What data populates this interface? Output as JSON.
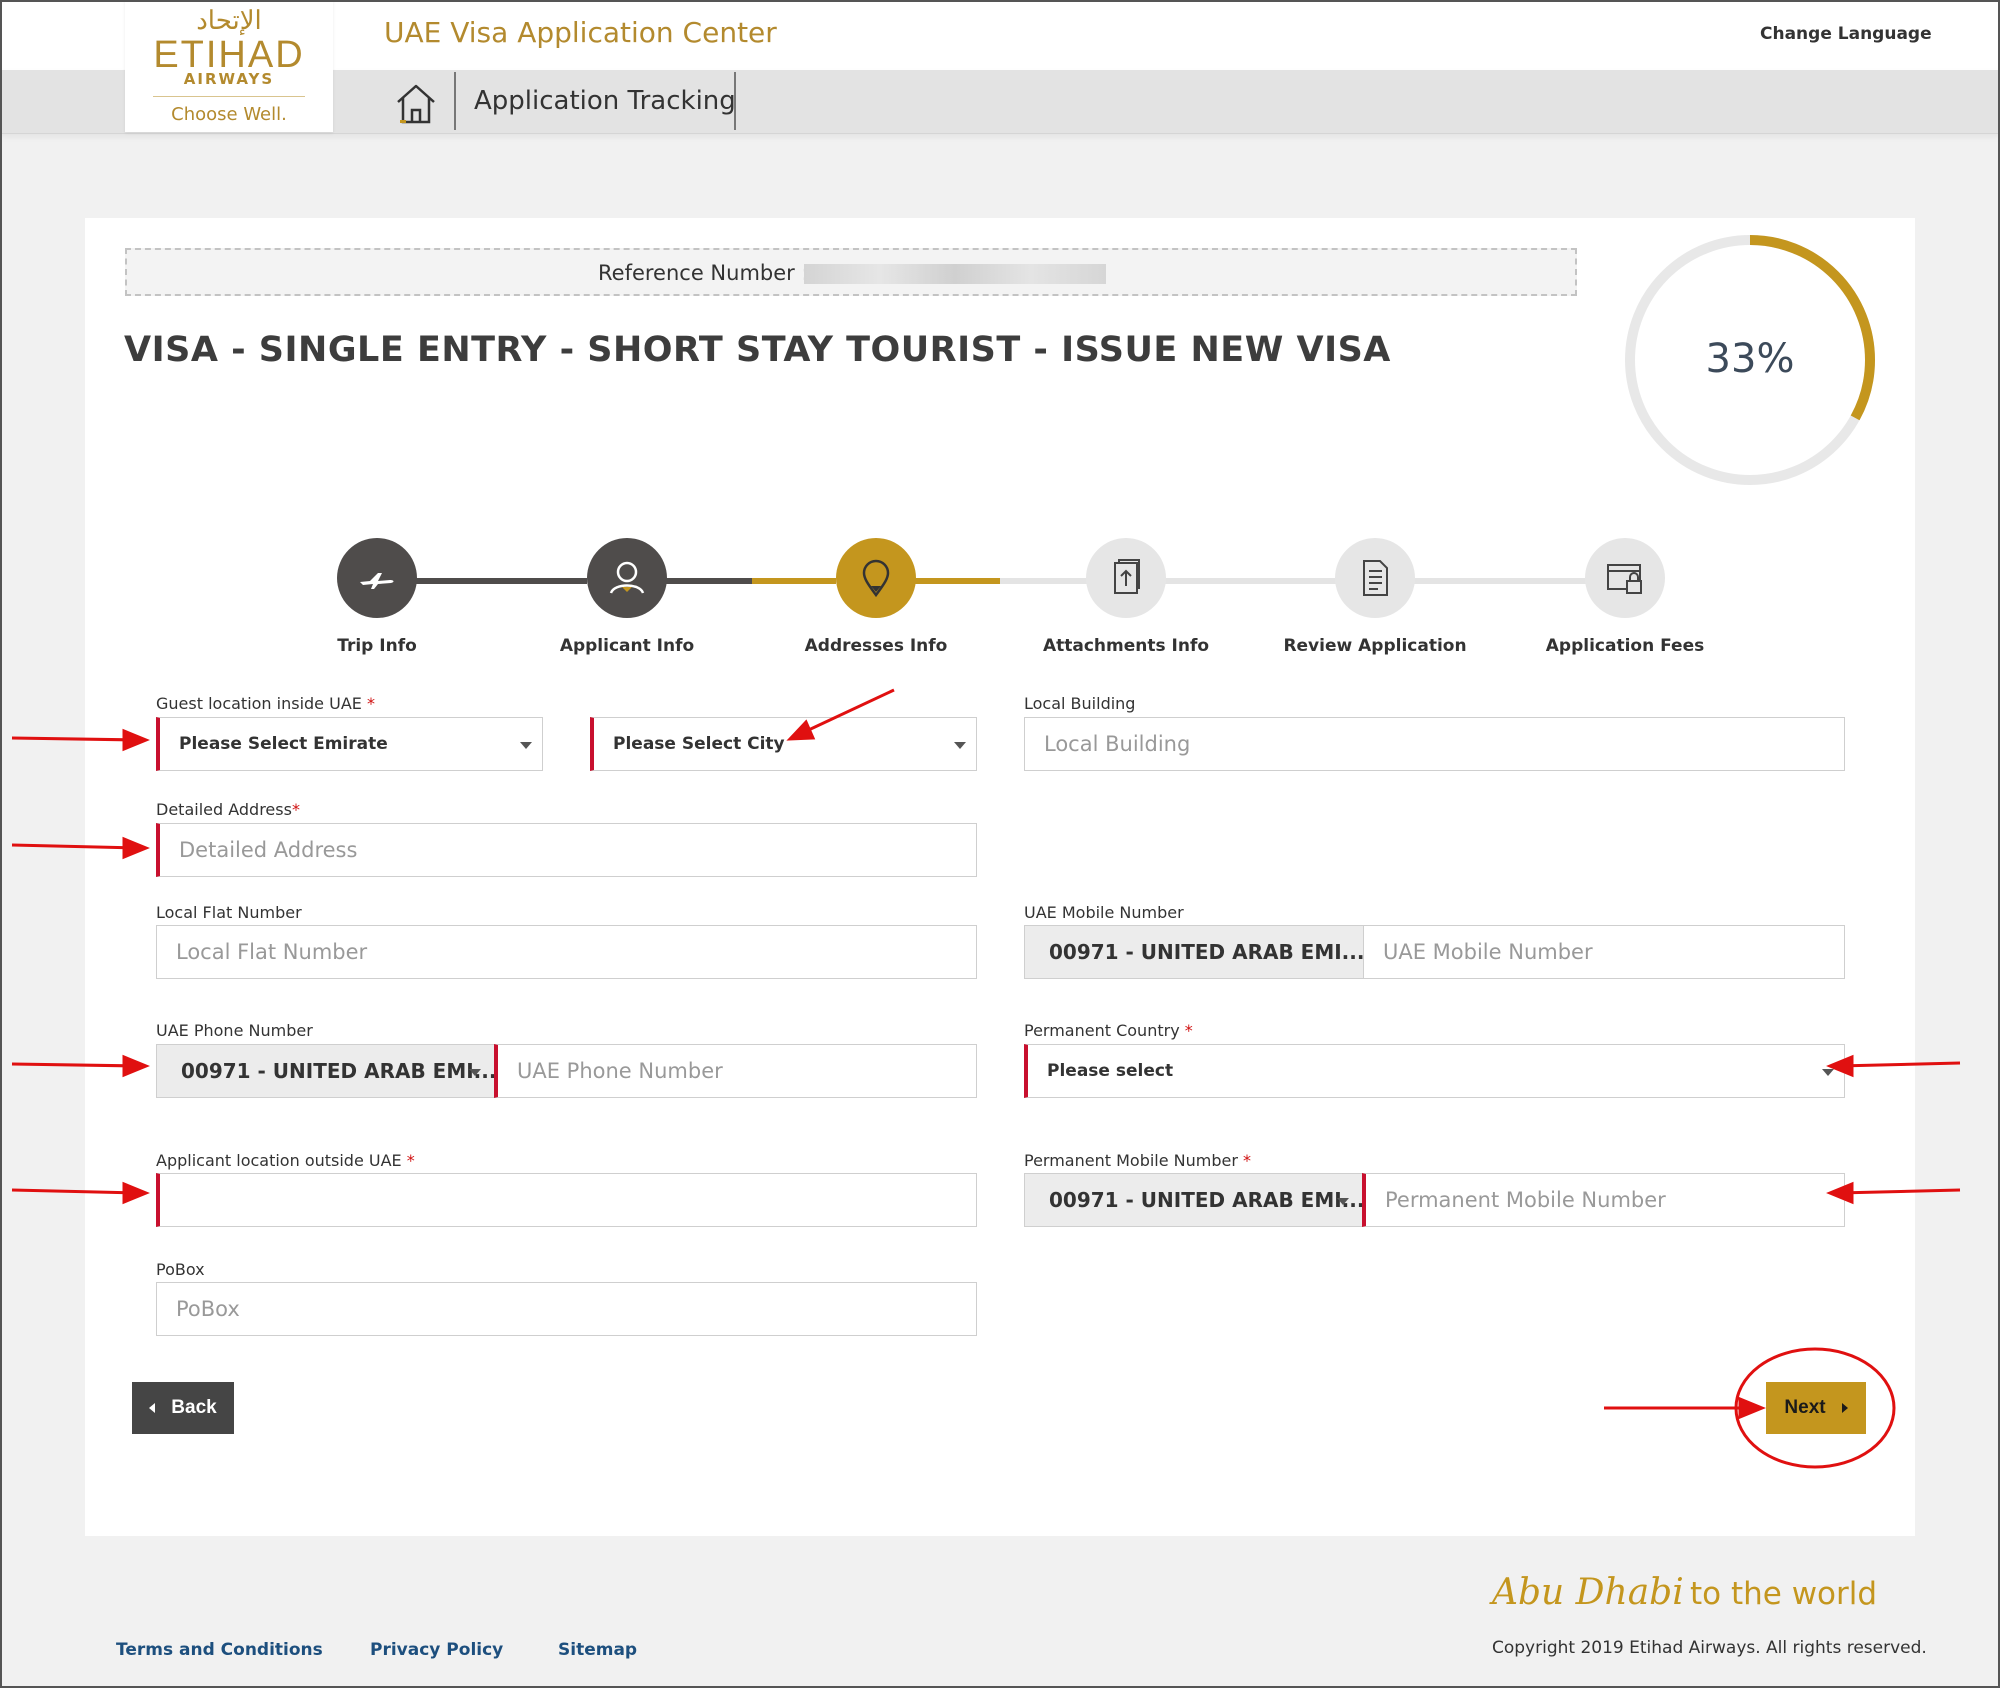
{
  "header": {
    "logo_arabic": "الإتحاد",
    "logo_main": "ETIHAD",
    "logo_sub": "AIRWAYS",
    "logo_tagline": "Choose Well.",
    "site_title": "UAE Visa Application Center",
    "change_language": "Change Language",
    "nav_tracking": "Application Tracking"
  },
  "reference": {
    "label": "Reference Number :"
  },
  "visa_title": "VISA - SINGLE ENTRY - SHORT STAY TOURIST - ISSUE NEW VISA",
  "progress": {
    "percent": 33,
    "label": "33%"
  },
  "steps": [
    {
      "label": "Trip Info",
      "status": "done",
      "icon": "airplane-icon"
    },
    {
      "label": "Applicant Info",
      "status": "done",
      "icon": "user-icon"
    },
    {
      "label": "Addresses Info",
      "status": "active",
      "icon": "location-pin-icon"
    },
    {
      "label": "Attachments Info",
      "status": "todo",
      "icon": "upload-document-icon"
    },
    {
      "label": "Review Application",
      "status": "todo",
      "icon": "document-icon"
    },
    {
      "label": "Application Fees",
      "status": "todo",
      "icon": "locked-card-icon"
    }
  ],
  "form": {
    "guest_location": {
      "label": "Guest location inside UAE",
      "emirate_selected": "Please Select Emirate",
      "city_selected": "Please Select City"
    },
    "local_building": {
      "label": "Local Building",
      "placeholder": "Local Building",
      "value": ""
    },
    "detailed_address": {
      "label": "Detailed Address",
      "placeholder": "Detailed Address",
      "value": ""
    },
    "local_flat_number": {
      "label": "Local Flat Number",
      "placeholder": "Local Flat Number",
      "value": ""
    },
    "uae_mobile_number": {
      "label": "UAE Mobile Number",
      "code": "00971 - UNITED ARAB EMI...",
      "placeholder": "UAE Mobile Number",
      "value": ""
    },
    "uae_phone_number": {
      "label": "UAE Phone Number",
      "code": "00971 - UNITED ARAB EMI...",
      "placeholder": "UAE Phone Number",
      "value": ""
    },
    "permanent_country": {
      "label": "Permanent Country",
      "selected": "Please select"
    },
    "applicant_location_outside": {
      "label": "Applicant location outside UAE",
      "value": ""
    },
    "permanent_mobile_number": {
      "label": "Permanent Mobile Number",
      "code": "00971 - UNITED ARAB EMI...",
      "placeholder": "Permanent Mobile Number",
      "value": ""
    },
    "pobox": {
      "label": "PoBox",
      "placeholder": "PoBox",
      "value": ""
    },
    "required_mark": "*"
  },
  "buttons": {
    "back": "Back",
    "next": "Next"
  },
  "footer": {
    "links": [
      "Terms and Conditions",
      "Privacy Policy",
      "Sitemap"
    ],
    "slogan_script": "Abu Dhabi",
    "slogan_rest": "to the world",
    "copyright": "Copyright 2019 Etihad Airways. All rights reserved."
  },
  "colors": {
    "brand_gold": "#c4961e",
    "step_done": "#4f4c4b",
    "step_todo": "#e6e6e6",
    "required_bar": "#c8102e",
    "annotation_red": "#e01010",
    "footer_link": "#1d4f7e"
  }
}
